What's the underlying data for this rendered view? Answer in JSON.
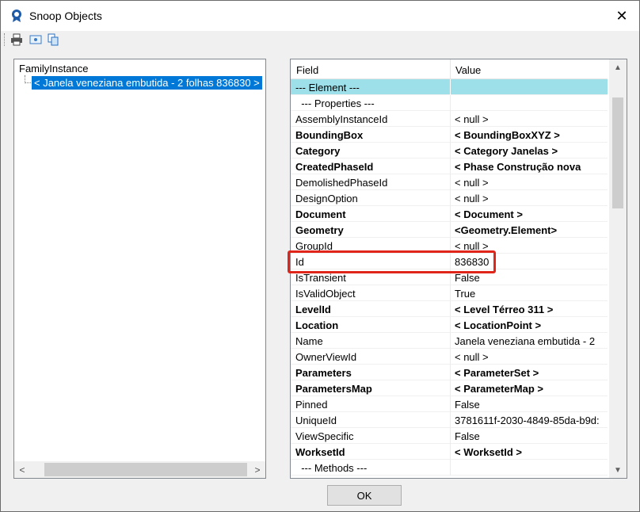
{
  "window": {
    "title": "Snoop Objects",
    "close_glyph": "✕"
  },
  "toolbar": {
    "icons": [
      "print-icon",
      "snoop-icon",
      "copy-icon"
    ]
  },
  "tree": {
    "root": "FamilyInstance",
    "selected_item": "< Janela veneziana embutida - 2 folhas  836830 >"
  },
  "grid": {
    "columns": {
      "field": "Field",
      "value": "Value"
    },
    "rows": [
      {
        "field": "--- Element ---",
        "value": "",
        "style": "highlight"
      },
      {
        "field": "  --- Properties ---",
        "value": "",
        "style": "section"
      },
      {
        "field": "AssemblyInstanceId",
        "value": "< null >",
        "style": "normal"
      },
      {
        "field": "BoundingBox",
        "value": "< BoundingBoxXYZ >",
        "style": "bold"
      },
      {
        "field": "Category",
        "value": "< Category  Janelas >",
        "style": "bold"
      },
      {
        "field": "CreatedPhaseId",
        "value": "< Phase  Construção nova",
        "style": "bold"
      },
      {
        "field": "DemolishedPhaseId",
        "value": "< null >",
        "style": "normal"
      },
      {
        "field": "DesignOption",
        "value": "< null >",
        "style": "normal"
      },
      {
        "field": "Document",
        "value": "< Document >",
        "style": "bold"
      },
      {
        "field": "Geometry",
        "value": "<Geometry.Element>",
        "style": "bold"
      },
      {
        "field": "GroupId",
        "value": "< null >",
        "style": "normal"
      },
      {
        "field": "Id",
        "value": "836830",
        "style": "normal"
      },
      {
        "field": "IsTransient",
        "value": "False",
        "style": "normal"
      },
      {
        "field": "IsValidObject",
        "value": "True",
        "style": "normal"
      },
      {
        "field": "LevelId",
        "value": "< Level  Térreo   311 >",
        "style": "bold"
      },
      {
        "field": "Location",
        "value": "< LocationPoint >",
        "style": "bold"
      },
      {
        "field": "Name",
        "value": "Janela veneziana embutida - 2",
        "style": "normal"
      },
      {
        "field": "OwnerViewId",
        "value": "< null >",
        "style": "normal"
      },
      {
        "field": "Parameters",
        "value": "< ParameterSet >",
        "style": "bold"
      },
      {
        "field": "ParametersMap",
        "value": "< ParameterMap >",
        "style": "bold"
      },
      {
        "field": "Pinned",
        "value": "False",
        "style": "normal"
      },
      {
        "field": "UniqueId",
        "value": "3781611f-2030-4849-85da-b9d:",
        "style": "normal"
      },
      {
        "field": "ViewSpecific",
        "value": "False",
        "style": "normal"
      },
      {
        "field": "WorksetId",
        "value": "< WorksetId >",
        "style": "bold"
      },
      {
        "field": "  --- Methods ---",
        "value": "",
        "style": "section"
      }
    ]
  },
  "buttons": {
    "ok": "OK"
  },
  "colors": {
    "selection": "#0078d7",
    "section_highlight": "#9ee0ea",
    "annotation_box": "#e0261b"
  }
}
